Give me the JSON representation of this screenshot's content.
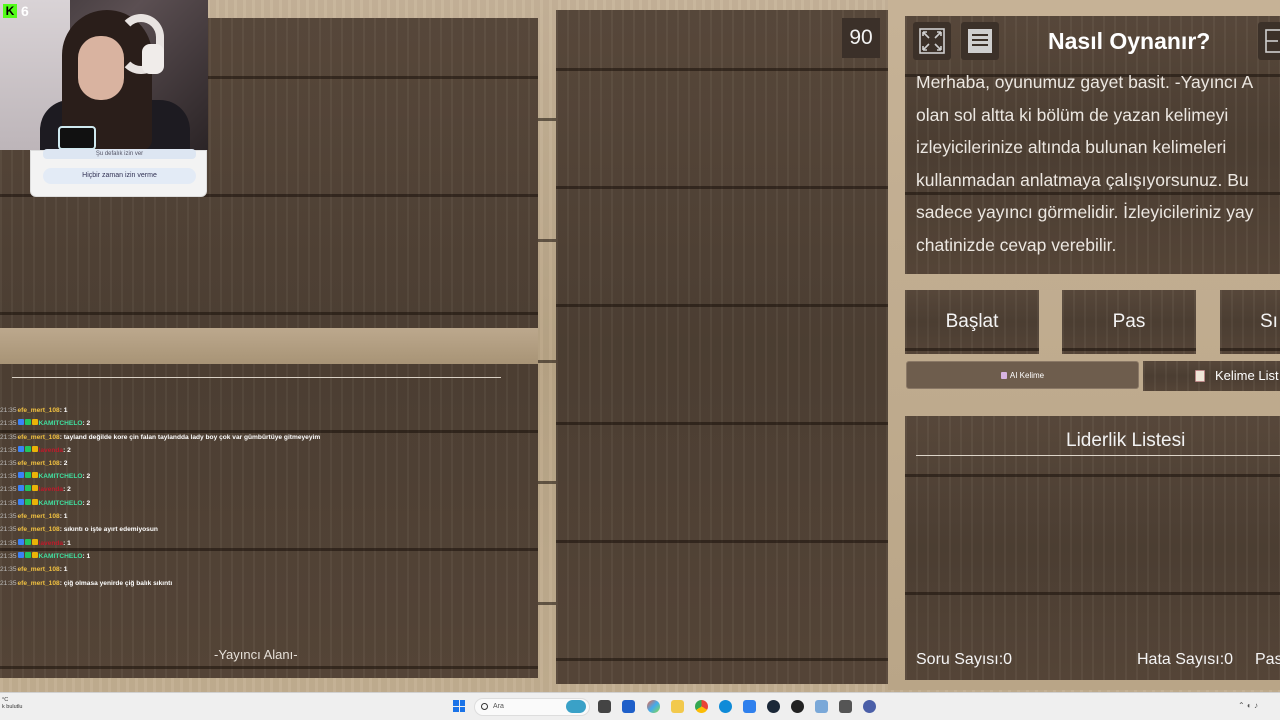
{
  "overlay": {
    "kick_count": "6",
    "popup_row_text": "Şu defalık izin ver",
    "popup_button": "Hiçbir zaman izin verme"
  },
  "chat": [
    {
      "time": "21:35",
      "user": "efe_mert_108",
      "user_color": "#f0c040",
      "message": ": 1",
      "badges": []
    },
    {
      "time": "21:35",
      "user": "KAMITCHELO",
      "user_color": "#40e0a0",
      "message": ": 2",
      "badges": [
        "#3b82f6",
        "#22c55e",
        "#eab308"
      ]
    },
    {
      "time": "21:35",
      "user": "efe_mert_108",
      "user_color": "#f0c040",
      "message": ": tayland değilde kore çin falan taylandda lady boy çok var gümbürtüye gitmeyeyim",
      "badges": []
    },
    {
      "time": "21:35",
      "user": "lavenda",
      "user_color": "#c0182a",
      "message": ": 2",
      "badges": [
        "#3b82f6",
        "#22c55e",
        "#eab308"
      ]
    },
    {
      "time": "21:35",
      "user": "efe_mert_108",
      "user_color": "#f0c040",
      "message": ": 2",
      "badges": []
    },
    {
      "time": "21:35",
      "user": "KAMITCHELO",
      "user_color": "#40e0a0",
      "message": ": 2",
      "badges": [
        "#3b82f6",
        "#22c55e",
        "#eab308"
      ]
    },
    {
      "time": "21:35",
      "user": "lavenda",
      "user_color": "#c0182a",
      "message": ": 2",
      "badges": [
        "#3b82f6",
        "#22c55e",
        "#eab308"
      ]
    },
    {
      "time": "21:35",
      "user": "KAMITCHELO",
      "user_color": "#40e0a0",
      "message": ": 2",
      "badges": [
        "#3b82f6",
        "#22c55e",
        "#eab308"
      ]
    },
    {
      "time": "21:35",
      "user": "efe_mert_108",
      "user_color": "#f0c040",
      "message": ": 1",
      "badges": []
    },
    {
      "time": "21:35",
      "user": "efe_mert_108",
      "user_color": "#f0c040",
      "message": ": sıkıntı o işte ayırt edemiyosun",
      "badges": []
    },
    {
      "time": "21:35",
      "user": "lavenda",
      "user_color": "#c0182a",
      "message": ": 1",
      "badges": [
        "#3b82f6",
        "#22c55e",
        "#eab308"
      ]
    },
    {
      "time": "21:35",
      "user": "KAMITCHELO",
      "user_color": "#40e0a0",
      "message": ": 1",
      "badges": [
        "#3b82f6",
        "#22c55e",
        "#eab308"
      ]
    },
    {
      "time": "21:35",
      "user": "efe_mert_108",
      "user_color": "#f0c040",
      "message": ": 1",
      "badges": []
    },
    {
      "time": "21:35",
      "user": "efe_mert_108",
      "user_color": "#f0c040",
      "message": ": çiğ olmasa yenirde çiğ balık sıkıntı",
      "badges": []
    }
  ],
  "streamer_area_label": "-Yayıncı Alanı-",
  "timer": "90",
  "howto": {
    "title": "Nasıl Oynanır?",
    "lines": [
      "Merhaba, oyunumuz gayet basit. -Yayıncı A",
      "olan sol altta ki bölüm de yazan kelimeyi",
      "izleyicilerinize altında bulunan kelimeleri",
      "kullanmadan anlatmaya çalışıyorsunuz. Bu",
      "sadece yayıncı görmelidir. İzleyicileriniz yay",
      "chatinizde cevap verebilir."
    ]
  },
  "buttons": {
    "start": "Başlat",
    "pass": "Pas",
    "next": "Sı",
    "ai_word": "AI Kelime",
    "word_list": "Kelime List"
  },
  "leaderboard": {
    "title": "Liderlik Listesi"
  },
  "stats": {
    "questions": "Soru Sayısı:0",
    "errors": "Hata Sayısı:0",
    "passes": "Pas"
  },
  "taskbar": {
    "search_placeholder": "Ara",
    "left_line1": "°C",
    "left_line2": "k bulutlu"
  },
  "colors": {
    "wood_dark": "#4e4034",
    "wood_light": "#c4b093",
    "button_bg": "#3c3129",
    "kick_green": "#53fc18"
  }
}
